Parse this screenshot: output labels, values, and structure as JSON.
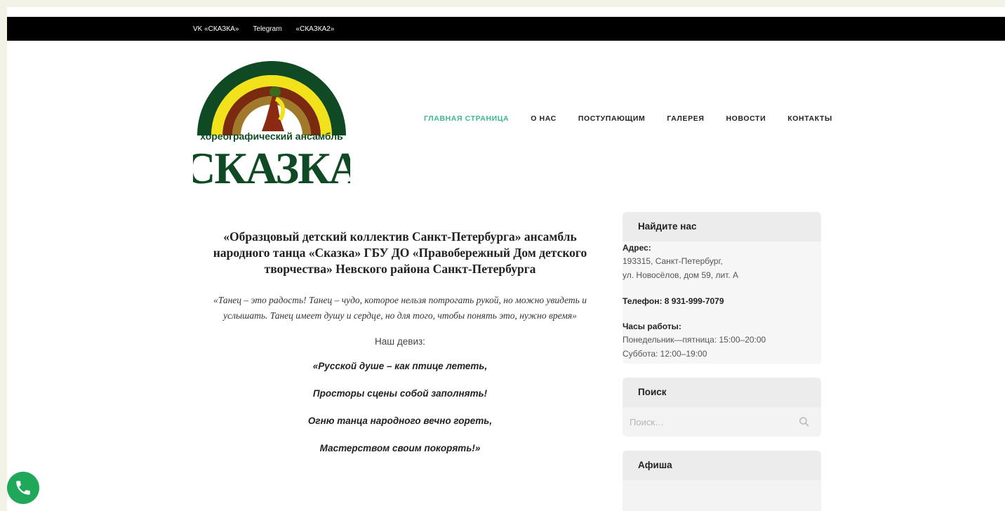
{
  "topbar": {
    "links": [
      "VK «СКАЗКА»",
      "Telegram",
      "«СКАЗКА2»"
    ]
  },
  "logo": {
    "line1": "хореографический ансамбль",
    "line2": "СКАЗКА"
  },
  "nav": {
    "items": [
      "ГЛАВНАЯ СТРАНИЦА",
      "О НАС",
      "ПОСТУПАЮЩИМ",
      "ГАЛЕРЕЯ",
      "НОВОСТИ",
      "КОНТАКТЫ"
    ],
    "active_color": "#3cb88d"
  },
  "main": {
    "title": "«Образцовый детский коллектив Санкт-Петербурга» ансамбль народного танца «Сказка» ГБУ ДО «Правобережный Дом детского творчества» Невского района Санкт-Петербурга",
    "quote": "«Танец – это радость! Танец – чудо, которое нельзя потрогать рукой, но можно увидеть и услышать. Танец имеет душу и сердце, но для того, чтобы понять это, нужно время»",
    "motto_label": "Наш девиз:",
    "motto": [
      "«Русской душе – как птице лететь,",
      "Просторы сцены собой заполнять!",
      "Огню танца народного вечно гореть,",
      "Мастерством своим покорять!»"
    ]
  },
  "sidebar": {
    "find_us": {
      "title": "Найдите нас",
      "address_label": "Адрес:",
      "address_line1": "193315, Санкт-Петербург,",
      "address_line2": "ул. Новосёлов, дом 59, лит. А",
      "phone": "Телефон: 8 931-999-7079",
      "hours_label": "Часы работы:",
      "hours_line1": "Понедельник—пятница: 15:00–20:00",
      "hours_line2": "Суббота: 12:00–19:00"
    },
    "search": {
      "title": "Поиск",
      "placeholder": "Поиск…",
      "icon": "search-icon"
    },
    "afisha": {
      "title": "Афиша"
    }
  },
  "call_button": {
    "icon": "phone-icon",
    "color": "#1fa85a"
  }
}
